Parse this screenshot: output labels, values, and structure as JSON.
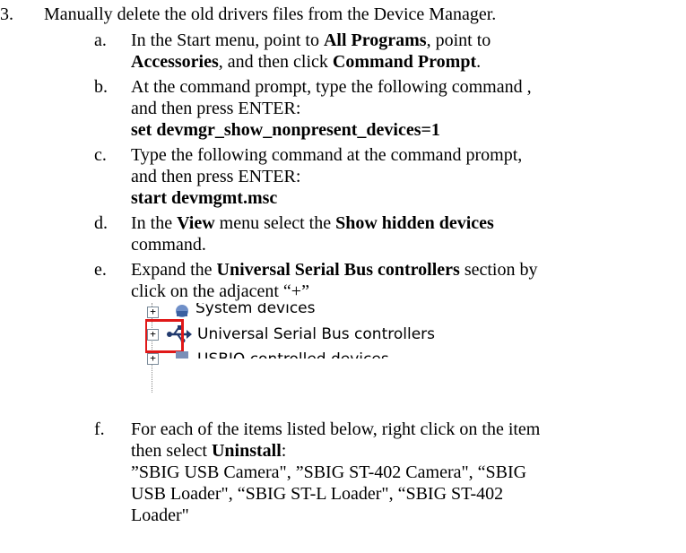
{
  "step": {
    "number": "3.",
    "text": "Manually delete the old drivers files from the Device Manager."
  },
  "items": [
    {
      "letter": "a.",
      "line1_pre": "In the Start menu, point to ",
      "line1_bold": "All Programs",
      "line1_post": ", point to",
      "line2_bold1": "Accessories",
      "line2_mid": ", and then click ",
      "line2_bold2": "Command Prompt",
      "line2_post": "."
    },
    {
      "letter": "b.",
      "line1": "At the command prompt, type the following command ,",
      "line2": "and then press ENTER:",
      "command": "set devmgr_show_nonpresent_devices=1"
    },
    {
      "letter": "c.",
      "line1": "Type the following command at the command prompt,",
      "line2": "and then press ENTER:",
      "command": "start devmgmt.msc"
    },
    {
      "letter": "d.",
      "line1_pre": "In the ",
      "line1_bold1": "View",
      "line1_mid": " menu select the ",
      "line1_bold2": "Show hidden devices",
      "line2": "command."
    },
    {
      "letter": "e.",
      "line1_pre": "Expand the ",
      "line1_bold": "Universal Serial Bus controllers",
      "line1_post": " section by",
      "line2": "click on the adjacent “+”"
    },
    {
      "letter": "f.",
      "line1": "For each of the items listed below, right click on the item",
      "line2_pre": "then select ",
      "line2_bold": "Uninstall",
      "line2_post": ":",
      "line3": "”SBIG USB Camera\", ”SBIG ST-402 Camera\", “SBIG",
      "line4": "USB Loader\", “SBIG ST-L Loader\", “SBIG ST-402",
      "line5": "Loader\""
    }
  ],
  "screenshot": {
    "row_above": "System devices",
    "row_main": "Universal Serial Bus controllers",
    "row_below": "USBIO controlled devices",
    "expand_glyph": "+",
    "highlight_color": "#e01818"
  }
}
